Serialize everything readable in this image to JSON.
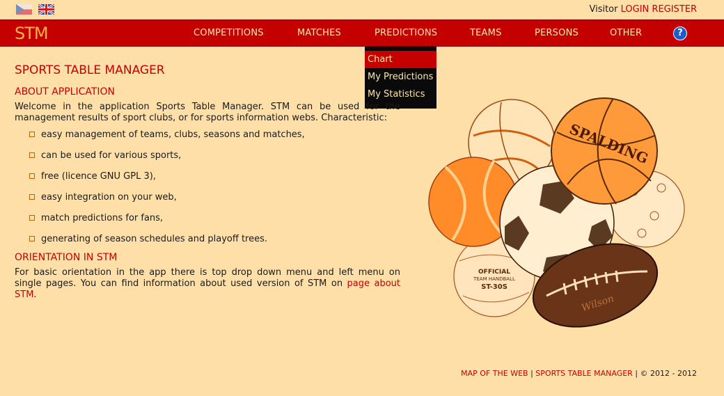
{
  "header": {
    "languages": [
      {
        "name": "cz-flag-icon"
      },
      {
        "name": "uk-flag-icon"
      }
    ],
    "user": {
      "visitor_label": "Visitor",
      "login_label": "LOGIN",
      "register_label": "REGISTER"
    }
  },
  "menu": {
    "logo": "STM",
    "items": [
      {
        "label": "COMPETITIONS"
      },
      {
        "label": "MATCHES"
      },
      {
        "label": "PREDICTIONS"
      },
      {
        "label": "TEAMS"
      },
      {
        "label": "PERSONS"
      },
      {
        "label": "OTHER"
      }
    ],
    "help_icon": "?"
  },
  "dropdown": {
    "items": [
      {
        "label": "Chart"
      },
      {
        "label": "My Predictions"
      },
      {
        "label": "My Statistics"
      }
    ]
  },
  "content": {
    "title": "SPORTS TABLE MANAGER",
    "about_heading": "ABOUT APPLICATION",
    "about_text": "Welcome in the application Sports Table Manager. STM can be used for the management results of sport clubs, or for sports information webs. Characteristic:",
    "features": [
      "easy management of teams, clubs, seasons and matches,",
      "can be used for various sports,",
      "free (licence GNU GPL 3),",
      "easy integration on your web,",
      "match predictions for fans,",
      "generating of season schedules and playoff trees."
    ],
    "orientation_heading": "ORIENTATION IN STM",
    "orientation_text": "For basic orientation in the app there is top drop down menu and left menu on single pages. You can find information about used version of STM on",
    "orientation_link": "page about STM",
    "orientation_end": "."
  },
  "illustration": {
    "basketball_text": "SPALDING",
    "football_text": "Wilson",
    "handball_text": "OFFICIAL TEAM HANDBALL ST-30S"
  },
  "footer": {
    "map_link": "MAP OF THE WEB",
    "sep1": "|",
    "stm_link": "SPORTS TABLE MANAGER",
    "sep2": "|",
    "copyright": "© 2012 - 2012"
  },
  "colors": {
    "background": "#ffdfa8",
    "menu_bar": "#c40000",
    "accent": "#c40000",
    "dropdown_bg": "#0a0a0a"
  }
}
